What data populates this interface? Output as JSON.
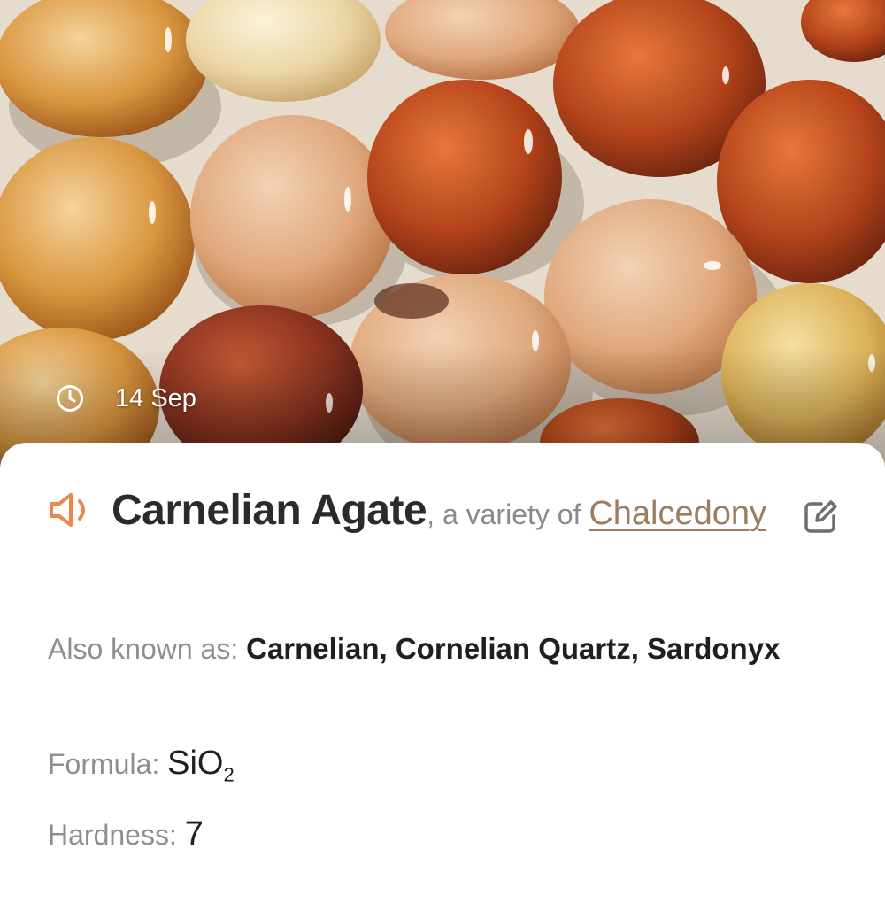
{
  "photo": {
    "date": "14 Sep",
    "icon": "clock-icon"
  },
  "card": {
    "speaker_icon": "speaker-icon",
    "name": "Carnelian Agate",
    "variety_text": ", a variety of ",
    "parent_mineral": "Chalcedony",
    "edit_icon": "edit-icon",
    "aka_label": "Also known as: ",
    "aka_value": "Carnelian, Cornelian Quartz, Sardonyx",
    "formula_label": "Formula: ",
    "formula_base": "SiO",
    "formula_sub": "2",
    "hardness_label": "Hardness: ",
    "hardness_value": "7"
  },
  "colors": {
    "accent_icon": "#e8884e",
    "link": "#9c7e5e",
    "label": "#8d8d92",
    "text": "#1f1f22"
  }
}
